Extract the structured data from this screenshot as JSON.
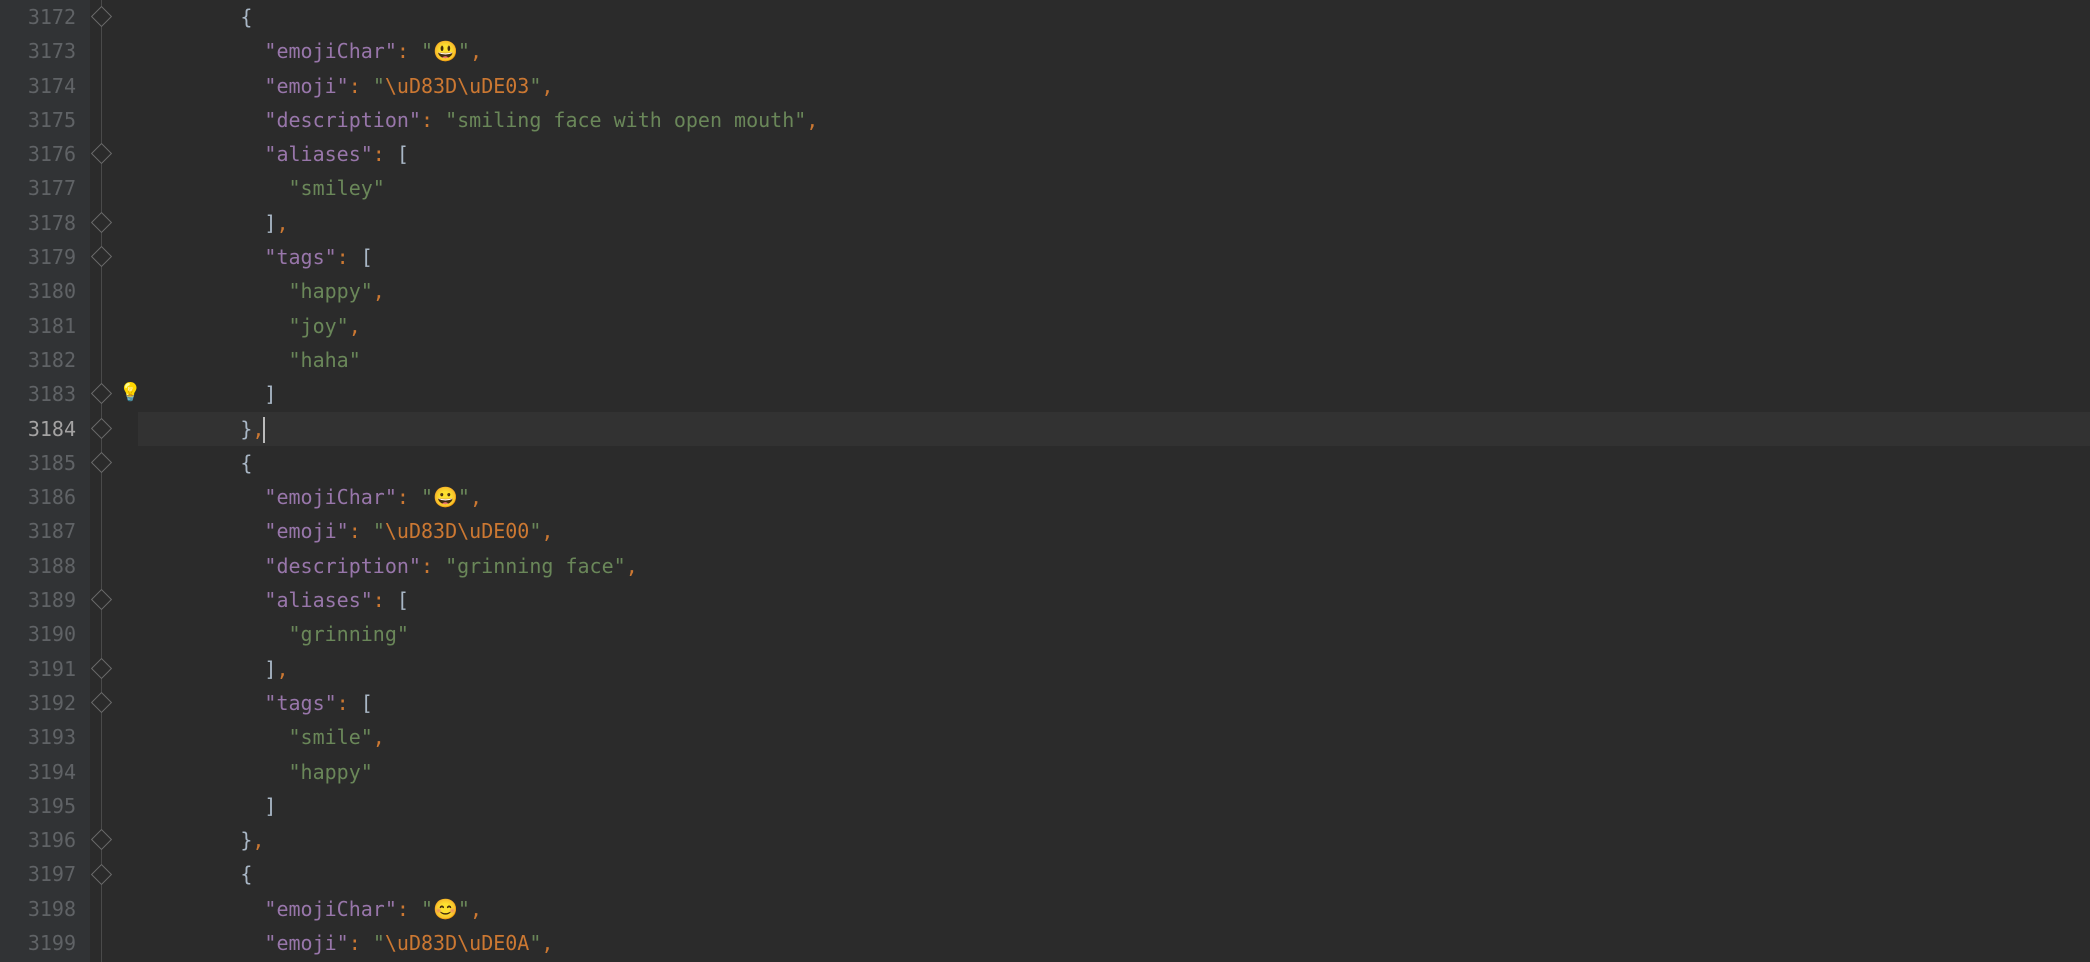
{
  "gutter": {
    "start": 3172,
    "end": 3199,
    "current": 3184
  },
  "fold_markers_rows": [
    0,
    4,
    6,
    7,
    11,
    12,
    13,
    17,
    19,
    20,
    24,
    25
  ],
  "bulb_row": 11,
  "code_lines": [
    {
      "indent": 4,
      "tokens": [
        {
          "t": "brace",
          "v": "{"
        }
      ]
    },
    {
      "indent": 5,
      "tokens": [
        {
          "t": "key",
          "v": "\"emojiChar\""
        },
        {
          "t": "colon",
          "v": ": "
        },
        {
          "t": "str",
          "v": "\""
        },
        {
          "t": "emoji",
          "v": "😃"
        },
        {
          "t": "str",
          "v": "\""
        },
        {
          "t": "comma",
          "v": ","
        }
      ]
    },
    {
      "indent": 5,
      "tokens": [
        {
          "t": "key",
          "v": "\"emoji\""
        },
        {
          "t": "colon",
          "v": ": "
        },
        {
          "t": "str",
          "v": "\""
        },
        {
          "t": "esc",
          "v": "\\uD83D\\uDE03"
        },
        {
          "t": "str",
          "v": "\""
        },
        {
          "t": "comma",
          "v": ","
        }
      ]
    },
    {
      "indent": 5,
      "tokens": [
        {
          "t": "key",
          "v": "\"description\""
        },
        {
          "t": "colon",
          "v": ": "
        },
        {
          "t": "str",
          "v": "\"smiling face with open mouth\""
        },
        {
          "t": "comma",
          "v": ","
        }
      ]
    },
    {
      "indent": 5,
      "tokens": [
        {
          "t": "key",
          "v": "\"aliases\""
        },
        {
          "t": "colon",
          "v": ": "
        },
        {
          "t": "brace",
          "v": "["
        }
      ]
    },
    {
      "indent": 6,
      "tokens": [
        {
          "t": "str",
          "v": "\"smiley\""
        }
      ]
    },
    {
      "indent": 5,
      "tokens": [
        {
          "t": "brace",
          "v": "]"
        },
        {
          "t": "comma",
          "v": ","
        }
      ]
    },
    {
      "indent": 5,
      "tokens": [
        {
          "t": "key",
          "v": "\"tags\""
        },
        {
          "t": "colon",
          "v": ": "
        },
        {
          "t": "brace",
          "v": "["
        }
      ]
    },
    {
      "indent": 6,
      "tokens": [
        {
          "t": "str",
          "v": "\"happy\""
        },
        {
          "t": "comma",
          "v": ","
        }
      ]
    },
    {
      "indent": 6,
      "tokens": [
        {
          "t": "str",
          "v": "\"joy\""
        },
        {
          "t": "comma",
          "v": ","
        }
      ]
    },
    {
      "indent": 6,
      "tokens": [
        {
          "t": "str",
          "v": "\"haha\""
        }
      ]
    },
    {
      "indent": 5,
      "tokens": [
        {
          "t": "brace",
          "v": "]"
        }
      ]
    },
    {
      "indent": 4,
      "tokens": [
        {
          "t": "brace",
          "v": "}"
        },
        {
          "t": "comma",
          "v": ","
        }
      ],
      "caret": true,
      "current": true
    },
    {
      "indent": 4,
      "tokens": [
        {
          "t": "brace",
          "v": "{"
        }
      ]
    },
    {
      "indent": 5,
      "tokens": [
        {
          "t": "key",
          "v": "\"emojiChar\""
        },
        {
          "t": "colon",
          "v": ": "
        },
        {
          "t": "str",
          "v": "\""
        },
        {
          "t": "emoji",
          "v": "😀"
        },
        {
          "t": "str",
          "v": "\""
        },
        {
          "t": "comma",
          "v": ","
        }
      ]
    },
    {
      "indent": 5,
      "tokens": [
        {
          "t": "key",
          "v": "\"emoji\""
        },
        {
          "t": "colon",
          "v": ": "
        },
        {
          "t": "str",
          "v": "\""
        },
        {
          "t": "esc",
          "v": "\\uD83D\\uDE00"
        },
        {
          "t": "str",
          "v": "\""
        },
        {
          "t": "comma",
          "v": ","
        }
      ]
    },
    {
      "indent": 5,
      "tokens": [
        {
          "t": "key",
          "v": "\"description\""
        },
        {
          "t": "colon",
          "v": ": "
        },
        {
          "t": "str",
          "v": "\"grinning face\""
        },
        {
          "t": "comma",
          "v": ","
        }
      ]
    },
    {
      "indent": 5,
      "tokens": [
        {
          "t": "key",
          "v": "\"aliases\""
        },
        {
          "t": "colon",
          "v": ": "
        },
        {
          "t": "brace",
          "v": "["
        }
      ]
    },
    {
      "indent": 6,
      "tokens": [
        {
          "t": "str",
          "v": "\"grinning\""
        }
      ]
    },
    {
      "indent": 5,
      "tokens": [
        {
          "t": "brace",
          "v": "]"
        },
        {
          "t": "comma",
          "v": ","
        }
      ]
    },
    {
      "indent": 5,
      "tokens": [
        {
          "t": "key",
          "v": "\"tags\""
        },
        {
          "t": "colon",
          "v": ": "
        },
        {
          "t": "brace",
          "v": "["
        }
      ]
    },
    {
      "indent": 6,
      "tokens": [
        {
          "t": "str",
          "v": "\"smile\""
        },
        {
          "t": "comma",
          "v": ","
        }
      ]
    },
    {
      "indent": 6,
      "tokens": [
        {
          "t": "str",
          "v": "\"happy\""
        }
      ]
    },
    {
      "indent": 5,
      "tokens": [
        {
          "t": "brace",
          "v": "]"
        }
      ]
    },
    {
      "indent": 4,
      "tokens": [
        {
          "t": "brace",
          "v": "}"
        },
        {
          "t": "comma",
          "v": ","
        }
      ]
    },
    {
      "indent": 4,
      "tokens": [
        {
          "t": "brace",
          "v": "{"
        }
      ]
    },
    {
      "indent": 5,
      "tokens": [
        {
          "t": "key",
          "v": "\"emojiChar\""
        },
        {
          "t": "colon",
          "v": ": "
        },
        {
          "t": "str",
          "v": "\""
        },
        {
          "t": "emoji",
          "v": "😊"
        },
        {
          "t": "str",
          "v": "\""
        },
        {
          "t": "comma",
          "v": ","
        }
      ]
    },
    {
      "indent": 5,
      "tokens": [
        {
          "t": "key",
          "v": "\"emoji\""
        },
        {
          "t": "colon",
          "v": ": "
        },
        {
          "t": "str",
          "v": "\""
        },
        {
          "t": "esc",
          "v": "\\uD83D\\uDE0A"
        },
        {
          "t": "str",
          "v": "\""
        },
        {
          "t": "comma",
          "v": ","
        }
      ]
    }
  ]
}
